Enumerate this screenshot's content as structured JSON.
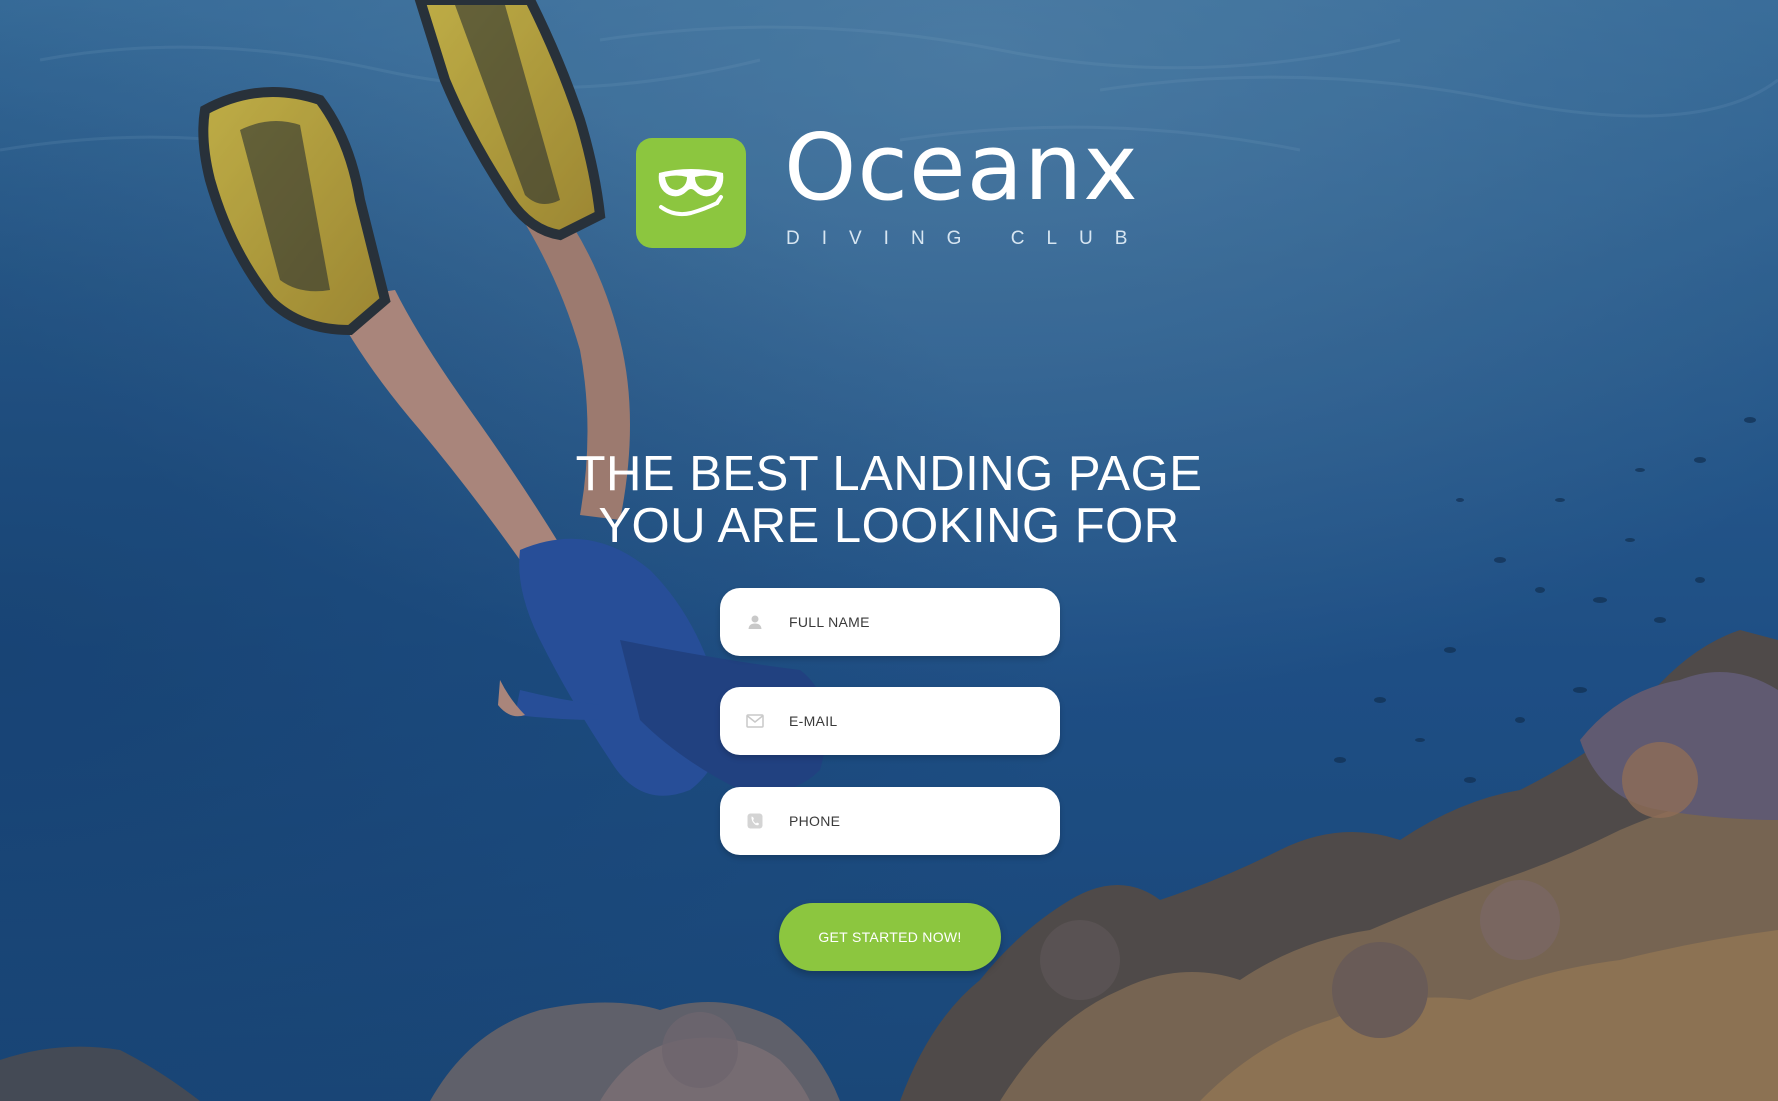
{
  "brand": {
    "name": "Oceanx",
    "tagline": "DIVING CLUB",
    "logo_icon": "diving-mask-icon",
    "accent_color": "#8cc63f"
  },
  "hero": {
    "headline_line1": "THE BEST LANDING PAGE",
    "headline_line2": "YOU ARE LOOKING FOR",
    "background": "underwater-diver-photo"
  },
  "form": {
    "fields": [
      {
        "placeholder": "FULL NAME",
        "icon": "user-icon"
      },
      {
        "placeholder": "E-MAIL",
        "icon": "envelope-icon"
      },
      {
        "placeholder": "PHONE",
        "icon": "phone-icon"
      }
    ],
    "submit_label": "GET STARTED NOW!"
  }
}
